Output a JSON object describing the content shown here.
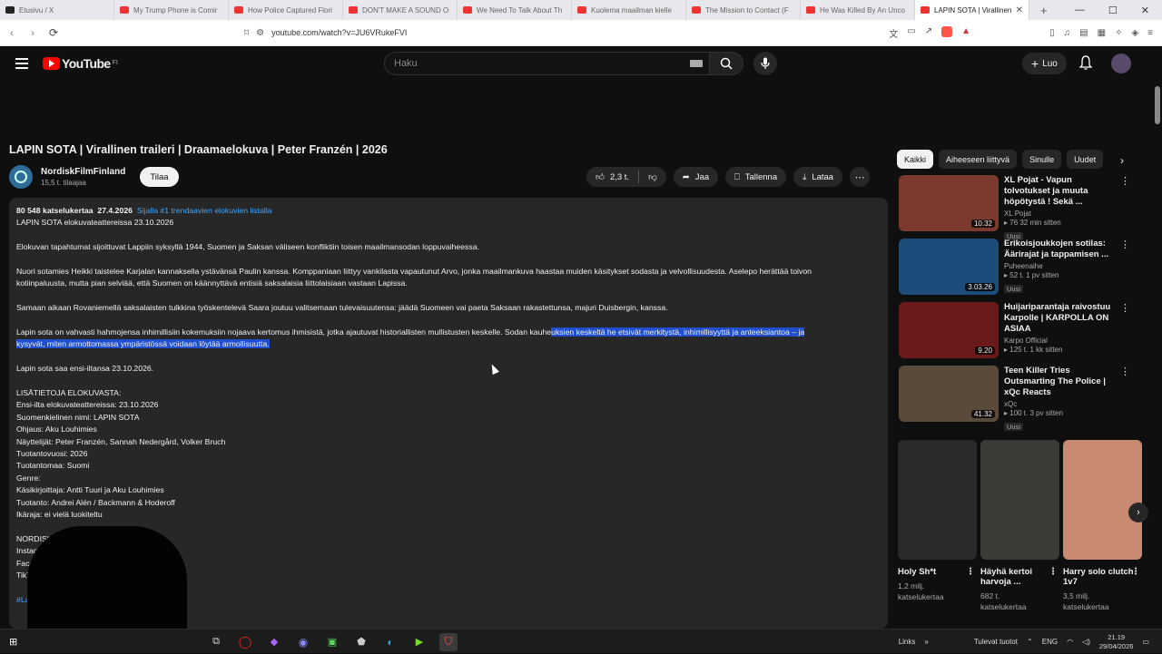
{
  "browser": {
    "tabs": [
      {
        "label": "Etusivu / X",
        "icon": "x-icon",
        "color": "#222222"
      },
      {
        "label": "My Trump Phone is Comir",
        "icon": "youtube-icon",
        "color": "#ee3333"
      },
      {
        "label": "How Police Captured Flori",
        "icon": "youtube-icon",
        "color": "#ee3333"
      },
      {
        "label": "DON'T MAKE A SOUND O",
        "icon": "youtube-icon",
        "color": "#ee3333"
      },
      {
        "label": "We Need To Talk About Th",
        "icon": "youtube-icon",
        "color": "#ee3333"
      },
      {
        "label": "Kuolema maailman kielle",
        "icon": "youtube-icon",
        "color": "#ee3333"
      },
      {
        "label": "The Mission to Contact (F",
        "icon": "youtube-icon",
        "color": "#ee3333"
      },
      {
        "label": "He Was Killed By An Unco",
        "icon": "youtube-icon",
        "color": "#ee3333"
      },
      {
        "label": "LAPIN SOTA | Virallinen",
        "icon": "youtube-icon",
        "color": "#ee3333",
        "active": true
      }
    ],
    "url": "youtube.com/watch?v=JU6VRukeFVI"
  },
  "header": {
    "logo_text": "YouTube",
    "logo_region": "FI",
    "search_placeholder": "Haku",
    "create_label": "Luo"
  },
  "video": {
    "title": "LAPIN SOTA | Virallinen traileri | Draamaelokuva | Peter Franzén | 2026",
    "channel": "NordiskFilmFinland",
    "subscribers": "15,5 t. tilaajaa",
    "subscribe_label": "Tilaa",
    "likes": "2,3 t.",
    "share_label": "Jaa",
    "save_label": "Tallenna",
    "download_label": "Lataa"
  },
  "description": {
    "views": "80 548 katselukertaa",
    "date": "27.4.2026",
    "trending": "Sijalla #1 trendaavien elokuvien listalla",
    "lines": [
      "LAPIN SOTA elokuvateattereissa 23.10.2026",
      "Elokuvan tapahtumat sijoittuvat Lappiin syksyllä 1944, Suomen ja Saksan väliseen konfliktiin toisen maailmansodan loppuvaiheessa.",
      "Nuori sotamies Heikki taistelee Karjalan kannaksella ystävänsä Paulin kanssa. Komppaniaan liittyy vankilasta vapautunut Arvo, jonka maailmankuva haastaa muiden käsitykset sodasta ja velvollisuudesta. Aselepo herättää toivon",
      "kotiinpaluusta, mutta pian selviää, että Suomen on käännyttävä entisiä saksalaisia liittolaisiaan vastaan Lapissa.",
      "Samaan aikaan Rovaniemellä saksalaisten tulkkina työskentelevä Saara joutuu valitsemaan tulevaisuutensa: jäädä Suomeen vai paeta Saksaan rakastettunsa, majuri Duisbergin, kanssa.",
      "Lapin sota on vahvasti hahmojensa inhimillisiin kokemuksiin nojaava kertomus ihmisistä, jotka ajautuvat historiallisten mullistusten keskelle. Sodan kauhe",
      "uksien keskeltä he etsivät merkitystä, inhimillisyyttä ja anteeksiantoa – ja",
      "kysyvät, miten armottomassa ympäristössä voidaan löytää armollisuutta.",
      "Lapin sota saa ensi-iltansa 23.10.2026.",
      "LISÄTIETOJA ELOKUVASTA:",
      "Ensi-ilta elokuvateattereissa: 23.10.2026",
      "Suomenkielinen nimi: LAPIN SOTA",
      "Ohjaus: Aku Louhimies",
      "Näyttelijät: Peter Franzén, Sannah Nedergård, Volker Bruch",
      "Tuotantovuosi: 2026",
      "Tuotantomaa: Suomi",
      "Genre:",
      "Käsikirjoittaja: Antti Tuuri ja Aku Louhimies",
      "Tuotanto: Andrei Alén / Backmann & Hoderoff",
      "Ikäraja: ei vielä luokiteltu",
      "NORDISK FILM ON",
      "Instagram:",
      "Facebook",
      "TikTok",
      "#Lap"
    ]
  },
  "chips": [
    "Kaikki",
    "Aiheeseen liittyvä",
    "Sinulle",
    "Uudet"
  ],
  "recommendations": [
    {
      "title": "XL Pojat - Vapun tolvotukset ja muuta höpötystä ! Sekä ...",
      "channel": "XL Pojat",
      "meta": "▸ 76  32 min sitten",
      "badge": "Uusi",
      "duration": "10.32",
      "thumb": "#7a3b2e"
    },
    {
      "title": "Erikoisjoukkojen sotilas: Äärirajat ja tappamisen ...",
      "channel": "Puheenaihe",
      "meta": "▸ 52 t.  1 pv sitten",
      "badge": "Uusi",
      "duration": "3.03.26",
      "thumb": "#1c4d7a"
    },
    {
      "title": "Huijariparantaja raivostuu Karpolle | KARPOLLA ON ASIAA",
      "channel": "Karpo Official",
      "meta": "▸ 125 t.  1 kk sitten",
      "badge": "",
      "duration": "9.20",
      "thumb": "#6a1a1a"
    },
    {
      "title": "Teen Killer Tries Outsmarting The Police | xQc Reacts",
      "channel": "xQc",
      "meta": "▸ 100 t.  3 pv sitten",
      "badge": "Uusi",
      "duration": "41.32",
      "thumb": "#5a4a3a"
    }
  ],
  "shorts": [
    {
      "title": "Holy Sh*t",
      "views_line1": "1,2 milj.",
      "views_line2": "katselukertaa",
      "thumb": "#2a2a2a"
    },
    {
      "title": "Häyhä kertoi harvoja ...",
      "views_line1": "682 t.",
      "views_line2": "katselukertaa",
      "thumb": "#3a3a36"
    },
    {
      "title": "Harry solo clutch 1v7",
      "views_line1": "3,5 milj.",
      "views_line2": "katselukertaa",
      "thumb": "#c88a70"
    }
  ],
  "taskbar": {
    "links_label": "Links",
    "weather": "Tulevat tuotot",
    "lang": "ENG",
    "time": "21.19",
    "date": "29/04/2026"
  }
}
